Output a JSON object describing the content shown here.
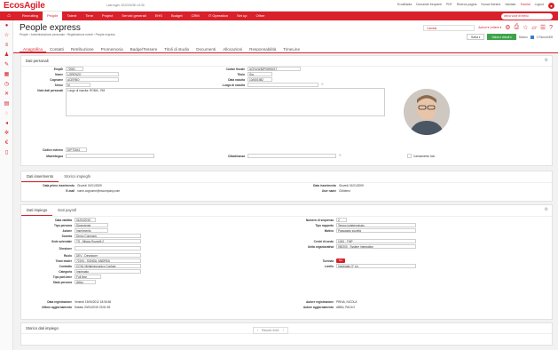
{
  "app": {
    "brand": "EcosAgile",
    "last_login": "Last login: 2022/04/30 14:30",
    "top_links": [
      "EcosBadia",
      "Domande frequenti",
      "PDF",
      "Ricerca pagina",
      "Nuova finestra",
      "Valutato",
      "Tutorial",
      "Logout"
    ]
  },
  "nav": {
    "items": [
      "Home",
      "Recruiting",
      "People",
      "Talent",
      "Time",
      "Project",
      "Servizi generali",
      "EHS",
      "Budget",
      "CRM",
      "IT Operation",
      "Set up",
      "Other"
    ],
    "active": "People",
    "search_placeholder": "cerca voce di menu"
  },
  "header": {
    "title": "People express",
    "breadcrumb": "People › Amministrazione personale › Registrazione eventi › People express",
    "change_label": "Cambia",
    "actions_label": "Azioni ▾ Lettere ▾",
    "save_label": "Salva ▾",
    "save_close_label": "Salva e chiudi ▾",
    "storico_label": "Storico",
    "record_label": "1 Record 8/8"
  },
  "tabs": [
    "Anagrafica",
    "Contatti",
    "Retribuzione",
    "Promemoria",
    "Badge/Tessere",
    "Titoli di studio",
    "Documenti",
    "Allocazioni",
    "Responsabilità",
    "TimeLine"
  ],
  "personal": {
    "title": "Dati personali",
    "fields": {
      "empid_label": "EmpID",
      "empid": "72081",
      "nome_label": "Nome",
      "nome": "LORENZO",
      "cognome_label": "Cognome",
      "cognome": "ACERBO",
      "sesso_label": "Sesso",
      "sesso": "M",
      "codfisc_label": "Codice fiscale",
      "codfisc": "ACRLNZ82P08H501T",
      "titolo_label": "Titolo",
      "titolo": "Sig.",
      "datanascita_label": "Data nascita",
      "datanascita": "10/08/1982",
      "luogo_label": "Luogo di nascita",
      "luogo": "",
      "note_label": "Note dati personali",
      "note": "Luogo di nascita: ROMA - RM",
      "codext_label": "Codice esterno",
      "codext": "DIPT2641",
      "madrelingua_label": "Madrelingua",
      "cittadinanza_label": "Cittadinanza",
      "foto_label": "Caricamento foto"
    }
  },
  "inserimento": {
    "tabs": [
      "Dati inserimento",
      "Storico impieghi"
    ],
    "primo_label": "Data primo inserimento",
    "primo": "Giovedì 01/01/2009",
    "email_label": "E-mail",
    "email": "nome.cognome@nscompany.com",
    "ins_label": "Data inserimento",
    "ins": "Giovedì 01/01/2009",
    "user_label": "User name",
    "user": "CMdemo"
  },
  "impiego": {
    "tabs": [
      "Dati impiego",
      "Dati payroll"
    ],
    "left": [
      {
        "label": "Data validità",
        "value": "01/04/2019"
      },
      {
        "label": "Tipo persona",
        "value": "Dipendente"
      },
      {
        "label": "Azione",
        "value": "Inserimento"
      },
      {
        "label": "Società",
        "value": "Demo Company"
      },
      {
        "label": "Sede aziendale",
        "value": "TS - Milano Rozzelli 2"
      },
      {
        "label": "Direzione",
        "value": ""
      },
      {
        "label": "Ruolo",
        "value": "DEV - Developer"
      },
      {
        "label": "Team leader",
        "value": "72194 - SONDA, ANDREA"
      },
      {
        "label": "Contratto",
        "value": "CCNL Metalmeccanico Confapi"
      },
      {
        "label": "Categoria",
        "value": "Impiegato"
      },
      {
        "label": "Tipo part-time",
        "value": "Full time"
      },
      {
        "label": "Stato persona",
        "value": "Attivo"
      }
    ],
    "right": [
      {
        "label": "Numero di sequenza",
        "value": "2"
      },
      {
        "label": "Tipo rapporto",
        "value": "Tempo indeterminato"
      },
      {
        "label": "Motivo",
        "value": "Passaggio società"
      },
      {
        "label": "Centri di costo",
        "value": "1000 - TMP"
      },
      {
        "label": "Unità organizzativa",
        "value": "050200 - System Integration"
      },
      {
        "label": "Livello",
        "value": "Impiegato 3° Liv."
      }
    ],
    "turnista_label": "Turnista",
    "turnista": "No",
    "reg_label": "Data registrazione",
    "reg": "Venerdì 15/06/2012 18:06:56",
    "last_label": "Ultimo aggiornamento",
    "last": "Sabato 20/04/2019 23:51:53",
    "autreg_label": "Autore registrazione",
    "autreg": "PRINA, NICOLA",
    "autagg_label": "Autore aggiornamento",
    "autagg": "ABBA, PAOLO"
  },
  "storico": {
    "title": "Storico dati impiego",
    "pager": "Record 4/4/2"
  }
}
